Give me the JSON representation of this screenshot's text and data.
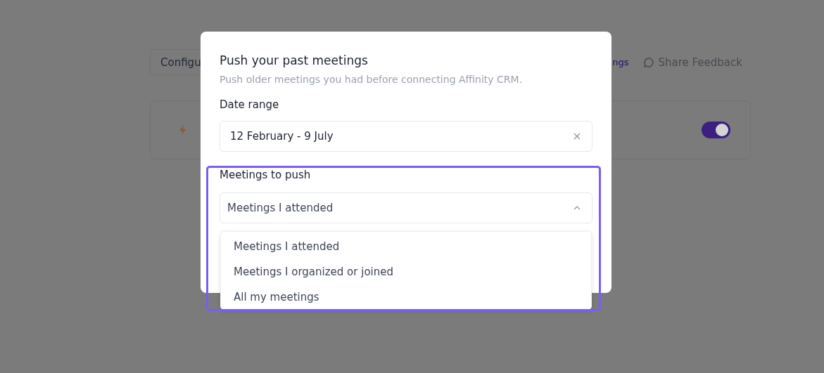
{
  "background": {
    "configure_button": "Configu",
    "link": "ngs",
    "feedback_link": "Share Feedback",
    "toggle": {
      "on": true
    }
  },
  "dialog": {
    "title": "Push your past meetings",
    "subtitle": "Push older meetings you had before connecting Affinity CRM.",
    "date_range": {
      "label": "Date range",
      "value": "12 February - 9 July"
    },
    "meetings": {
      "label": "Meetings to push",
      "value": "Meetings I attended",
      "expanded": true,
      "options": [
        "Meetings I attended",
        "Meetings I organized or joined",
        "All my meetings"
      ]
    }
  }
}
